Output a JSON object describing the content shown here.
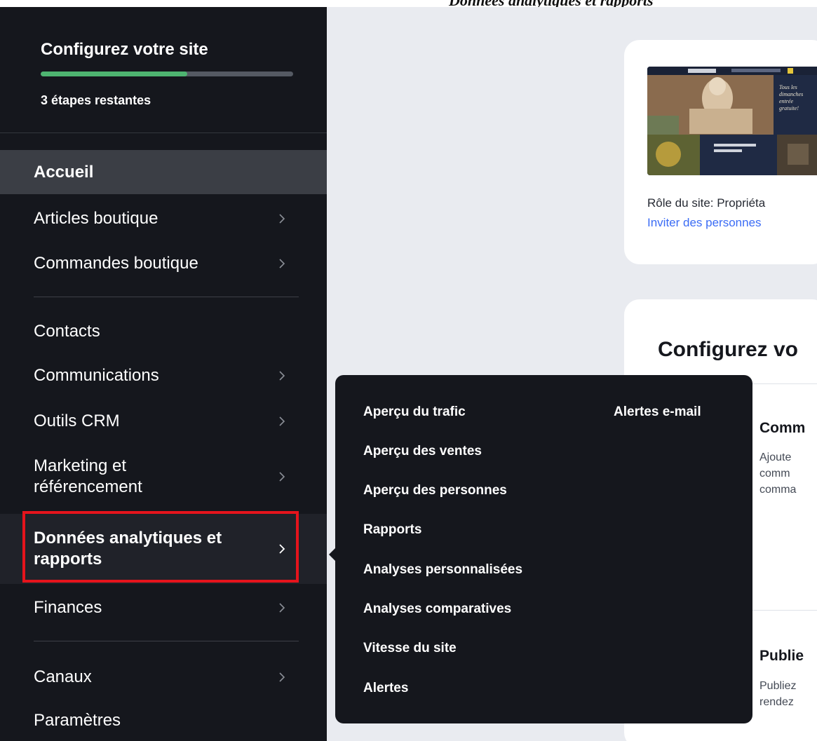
{
  "header": {
    "caption_partial": "Données analytiques et rapports"
  },
  "setup": {
    "title": "Configurez votre site",
    "progress_fraction": 0.58,
    "steps_remaining": "3 étapes restantes",
    "progress_color": "#4eb471"
  },
  "sidebar": {
    "items": [
      {
        "label": "Accueil",
        "has_submenu": false,
        "state": "active"
      },
      {
        "label": "Articles boutique",
        "has_submenu": true
      },
      {
        "label": "Commandes boutique",
        "has_submenu": true
      },
      {
        "label": "Contacts",
        "has_submenu": false
      },
      {
        "label": "Communications",
        "has_submenu": true
      },
      {
        "label": "Outils CRM",
        "has_submenu": true
      },
      {
        "label": "Marketing et référencement",
        "line1": "Marketing et",
        "line2": "référencement",
        "has_submenu": true
      },
      {
        "label": "Données analytiques et rapports",
        "line1": "Données analytiques et",
        "line2": "rapports",
        "has_submenu": true,
        "state": "hover-highlighted"
      },
      {
        "label": "Finances",
        "has_submenu": true
      },
      {
        "label": "Canaux",
        "has_submenu": true
      },
      {
        "label": "Paramètres",
        "has_submenu": false
      }
    ],
    "highlight_color": "#e5141c"
  },
  "flyout": {
    "items": [
      "Aperçu du trafic",
      "Aperçu des ventes",
      "Aperçu des personnes",
      "Rapports",
      "Analyses personnalisées",
      "Analyses comparatives",
      "Vitesse du site",
      "Alertes"
    ],
    "right_column": [
      "Alertes e-mail"
    ]
  },
  "site_card": {
    "role": "Rôle du site: Propriéta",
    "invite": "Inviter des personnes"
  },
  "setup_card": {
    "title": "Configurez vo",
    "task1_title": "Comm",
    "task1_desc": [
      "Ajoute",
      "comm",
      "comma"
    ],
    "task2_title": "Publie",
    "task2_desc": [
      "Publiez",
      "rendez"
    ]
  }
}
